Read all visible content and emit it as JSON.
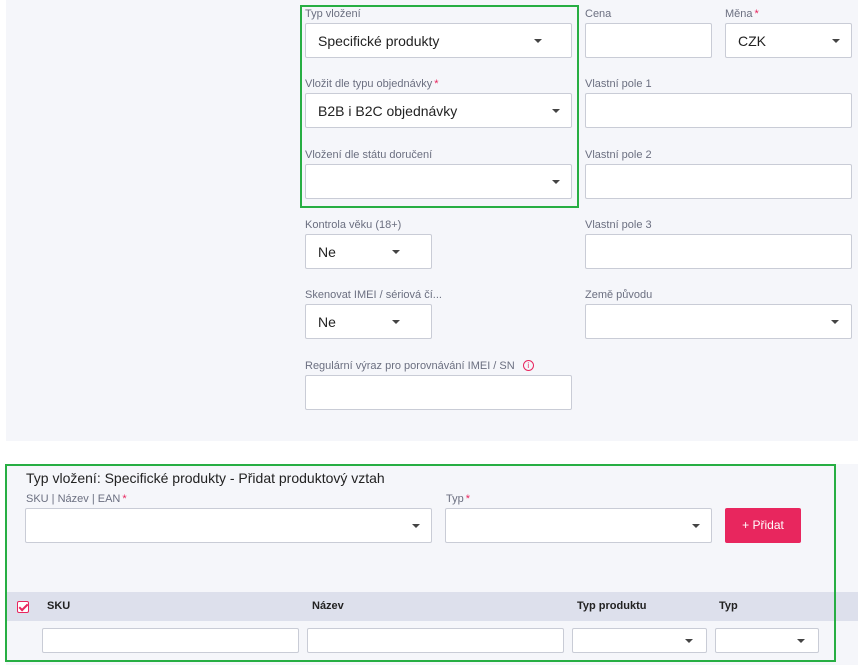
{
  "insert_form": {
    "typ_vlozeni": {
      "label": "Typ vložení",
      "value": "Specifické produkty"
    },
    "cena": {
      "label": "Cena",
      "value": ""
    },
    "mena": {
      "label": "Měna",
      "required": "*",
      "value": "CZK"
    },
    "vlozit_dle_typu": {
      "label": "Vložit dle typu objednávky",
      "required": "*",
      "value": "B2B i B2C objednávky"
    },
    "vlastni_pole_1": {
      "label": "Vlastní pole 1",
      "value": ""
    },
    "vlozeni_dle_statu": {
      "label": "Vložení dle státu doručení",
      "value": ""
    },
    "vlastni_pole_2": {
      "label": "Vlastní pole 2",
      "value": ""
    },
    "kontrola_veku": {
      "label": "Kontrola věku (18+)",
      "value": "Ne"
    },
    "vlastni_pole_3": {
      "label": "Vlastní pole 3",
      "value": ""
    },
    "skenovat_imei": {
      "label": "Skenovat IMEI / sériová čí...",
      "value": "Ne"
    },
    "zeme_puvodu": {
      "label": "Země původu",
      "value": ""
    },
    "regex": {
      "label": "Regulární výraz pro porovnávání IMEI / SN",
      "info_icon": "i",
      "value": ""
    }
  },
  "relation_section": {
    "title": "Typ vložení: Specifické produkty - Přidat produktový vztah",
    "sku_field": {
      "label": "SKU | Název | EAN",
      "required": "*",
      "value": ""
    },
    "typ_field": {
      "label": "Typ",
      "required": "*",
      "value": ""
    },
    "add_button": "+ Přidat",
    "table": {
      "columns": [
        "SKU",
        "Název",
        "Typ produktu",
        "Typ"
      ],
      "filters": {
        "sku": "",
        "nazev": "",
        "typ_produktu": "",
        "typ": ""
      }
    }
  },
  "colors": {
    "accent": "#e8265e",
    "highlight": "#27ae43",
    "panel": "#f5f6fa"
  },
  "icons": {
    "dropdown": "chevron-down-icon",
    "info": "info-icon",
    "checkbox": "checkbox-checked-icon"
  }
}
